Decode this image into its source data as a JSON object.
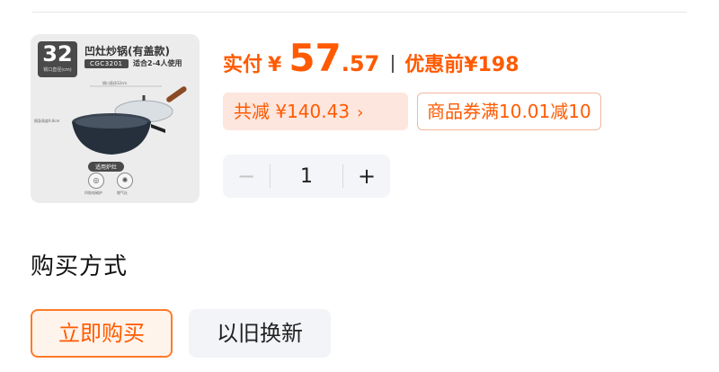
{
  "product": {
    "size_number": "32",
    "size_unit_label": "锅口直径(cm)",
    "name": "凹灶炒锅(有盖款)",
    "model": "CGC3201",
    "servings": "适合2-4人使用",
    "dimension_top": "锅口直径32cm",
    "dimension_side": "锅身高度9.8cm",
    "stove_tag": "适用炉灶",
    "stove_1": "凹陷电磁炉",
    "stove_2": "燃气灶"
  },
  "price": {
    "prefix": "实付",
    "currency": "¥",
    "integer": "57",
    "decimal": ".57",
    "original_label": "优惠前¥198"
  },
  "discount": {
    "label": "共减 ¥140.43",
    "chevron": "›"
  },
  "coupon": {
    "label": "商品券满10.01减10"
  },
  "quantity": {
    "minus": "−",
    "value": "1",
    "plus": "+"
  },
  "purchase": {
    "section_title": "购买方式",
    "option_buy_now": "立即购买",
    "option_trade_in": "以旧换新"
  },
  "colors": {
    "accent": "#ff5a00",
    "accent_light": "#fde6de",
    "control_bg": "#f4f5f8"
  }
}
